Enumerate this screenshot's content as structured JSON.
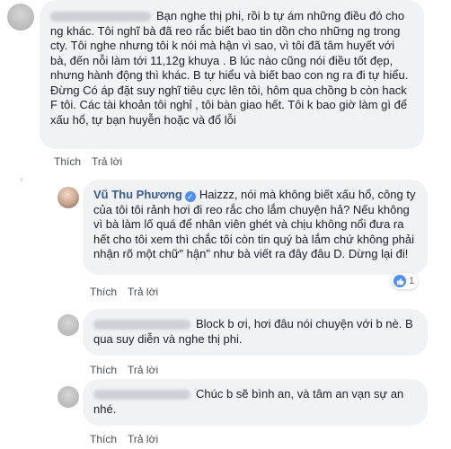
{
  "comments": [
    {
      "text": "Bạn nghe thị phi, rồi b tự ám những điều đó cho ng khác. Tôi nghĩ bà đã reo rắc biết bao tin dồn cho những ng trong cty. Tôi nghe nhưng tôi k nói mà hận vì sao, vì tôi đã tâm huyết với bà, đến nỗi làm tới 11,12g khuya . B lúc nào cũng nói điều tốt đẹp, nhưng hành động thì khác. B tự hiểu và biết bao con ng ra đi tự hiểu. Đừng Có áp đặt suy nghĩ tiêu cực lên tôi, hôm qua chồng b còn hack F tôi. Các tài khoản tôi nghỉ , tôi bàn giao hết. Tôi k bao giờ làm gì để xấu hổ, tự bạn huyễn hoặc và đổ lỗi",
      "like": "Thích",
      "reply": "Trả lời"
    },
    {
      "author": "Vũ Thu Phương",
      "text": "Haizzz, nói mà không biết xấu hổ, công ty của tôi tôi rảnh hơi đi reo rắc cho lắm chuyện hả? Nếu không vì bà làm lố quá để nhân viên ghét và chịu không nổi đưa ra hết cho tôi xem thì chắc tôi còn tin quý bà lắm chứ không phải nhận rõ một chữ\" hận\" như bà viết ra đây đâu D. Dừng lại đi!",
      "like": "Thích",
      "reply": "Trả lời",
      "reaction_count": "1"
    },
    {
      "text": "Block b ơi, hơi đâu nói chuyện với b nè. B qua suy diễn và nghe thị phi.",
      "like": "Thích",
      "reply": "Trả lời"
    },
    {
      "text": "Chúc b sẽ bình an, và tâm an vạn sự an nhé.",
      "like": "Thích",
      "reply": "Trả lời"
    }
  ],
  "colors": {
    "bubble": "#f1f2f4",
    "author": "#385898",
    "action": "#4b4f56",
    "like_blue": "#4d8ff5"
  }
}
